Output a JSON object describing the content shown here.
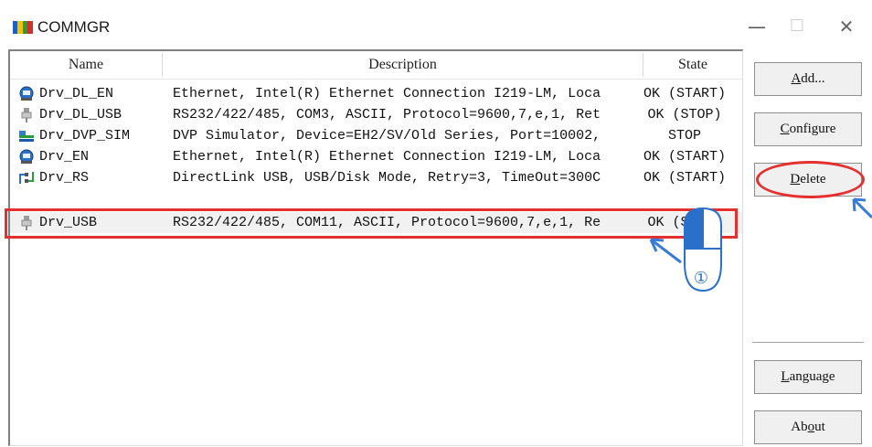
{
  "window": {
    "title": "COMMGR",
    "minimize_glyph": "—",
    "maximize_glyph": "☐",
    "close_glyph": "✕"
  },
  "table": {
    "columns": [
      "Name",
      "Description",
      "State"
    ],
    "rows": [
      {
        "icon": "ethernet-icon",
        "name": "Drv_DL_EN",
        "description": "Ethernet, Intel(R) Ethernet Connection I219-LM, Loca",
        "state": "OK (START)"
      },
      {
        "icon": "usb-plug-icon",
        "name": "Drv_DL_USB",
        "description": "RS232/422/485, COM3, ASCII, Protocol=9600,7,e,1, Ret",
        "state": "OK (STOP)"
      },
      {
        "icon": "simulator-icon",
        "name": "Drv_DVP_SIM",
        "description": "DVP Simulator, Device=EH2/SV/Old Series, Port=10002,",
        "state": "STOP"
      },
      {
        "icon": "ethernet-icon",
        "name": "Drv_EN",
        "description": "Ethernet, Intel(R) Ethernet Connection I219-LM, Loca",
        "state": "OK (START)"
      },
      {
        "icon": "usb-link-icon",
        "name": "Drv_RS",
        "description": "DirectLink USB, USB/Disk Mode, Retry=3, TimeOut=300C",
        "state": "OK (START)"
      },
      {
        "icon": "usb-plug-icon",
        "name": "Drv_USB",
        "description": "RS232/422/485, COM11, ASCII, Protocol=9600,7,e,1, Re",
        "state": "OK (STOP)",
        "selected": true
      }
    ]
  },
  "buttons": {
    "add": {
      "mnemonic": "A",
      "rest": "dd..."
    },
    "configure": {
      "mnemonic": "C",
      "rest": "onfigure"
    },
    "delete": {
      "mnemonic": "D",
      "rest": "elete"
    },
    "language": {
      "mnemonic": "L",
      "rest": "anguage"
    },
    "about": {
      "pre": "Ab",
      "mnemonic": "o",
      "rest": "ut"
    }
  },
  "annotation": {
    "step_label": "①",
    "highlight_color": "#e53030",
    "arrow_color": "#3a7bd5"
  }
}
